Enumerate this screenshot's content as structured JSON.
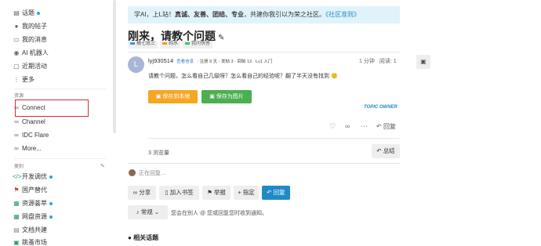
{
  "sidebar": {
    "items": [
      {
        "label": "话题",
        "icon": "topic-icon",
        "dot": true
      },
      {
        "label": "我的帖子",
        "icon": "user-icon",
        "dot": false
      },
      {
        "label": "我的消息",
        "icon": "message-icon",
        "dot": false
      },
      {
        "label": "AI 机器人",
        "icon": "robot-icon",
        "dot": false
      },
      {
        "label": "近期活动",
        "icon": "activity-icon",
        "dot": false
      },
      {
        "label": "更多",
        "icon": "more-icon",
        "dot": false
      }
    ],
    "resources_heading": "资源",
    "resources": [
      {
        "label": "Connect",
        "icon": "link-icon"
      },
      {
        "label": "Channel",
        "icon": "link-icon"
      },
      {
        "label": "IDC Flare",
        "icon": "link-icon"
      },
      {
        "label": "More...",
        "icon": "link-icon"
      }
    ],
    "categories_heading": "类别",
    "categories": [
      {
        "label": "开发调优",
        "icon": "code-icon",
        "dot": true
      },
      {
        "label": "国产替代",
        "icon": "flag-icon",
        "dot": false
      },
      {
        "label": "资源荟萃",
        "icon": "resource-icon",
        "dot": true
      },
      {
        "label": "网盘资源",
        "icon": "cloud-icon",
        "dot": true
      },
      {
        "label": "文档共建",
        "icon": "doc-icon",
        "dot": false
      },
      {
        "label": "跳蚤市场",
        "icon": "market-icon",
        "dot": false
      }
    ]
  },
  "banner": {
    "prefix": "学AI，上L站！",
    "bold": "真诚、友善、团结、专业",
    "suffix": "，共建你我引以为荣之社区。",
    "link": "《社区准则》"
  },
  "topic": {
    "title": "刚来，请教个问题",
    "tags": [
      "搞七捻三",
      "纯水",
      "我问快答"
    ]
  },
  "post": {
    "author": "lyj930514",
    "level_badge": "查看信息",
    "meta": "· 注册 9 天 · 发帖 3 · 回帖 13 · Lv1 入门",
    "time": "1 分钟",
    "reads": "阅读: 1",
    "body": "请教个问题，怎么看自己几级呀？怎么看自己的经验呢？翻了半天没有找到 🙂",
    "save_local": "保存到本地",
    "save_image": "保存为图片",
    "topic_owner": "TOPIC OWNER",
    "reply": "回复"
  },
  "footer": {
    "views": "3 浏览量",
    "summary": "总结",
    "composer_status": "正在回复…",
    "share": "分享",
    "bookmark": "加入书签",
    "flag": "举报",
    "assign": "指定",
    "reply": "回复",
    "notify": "常规",
    "notify_desc": "您会在别人 @ 您或回复您时收到通知。",
    "related": "相关话题"
  },
  "colors": {
    "accent": "#1f8ac6",
    "orange": "#f5a623",
    "green": "#4caf50",
    "highlight": "#d82a2a"
  }
}
